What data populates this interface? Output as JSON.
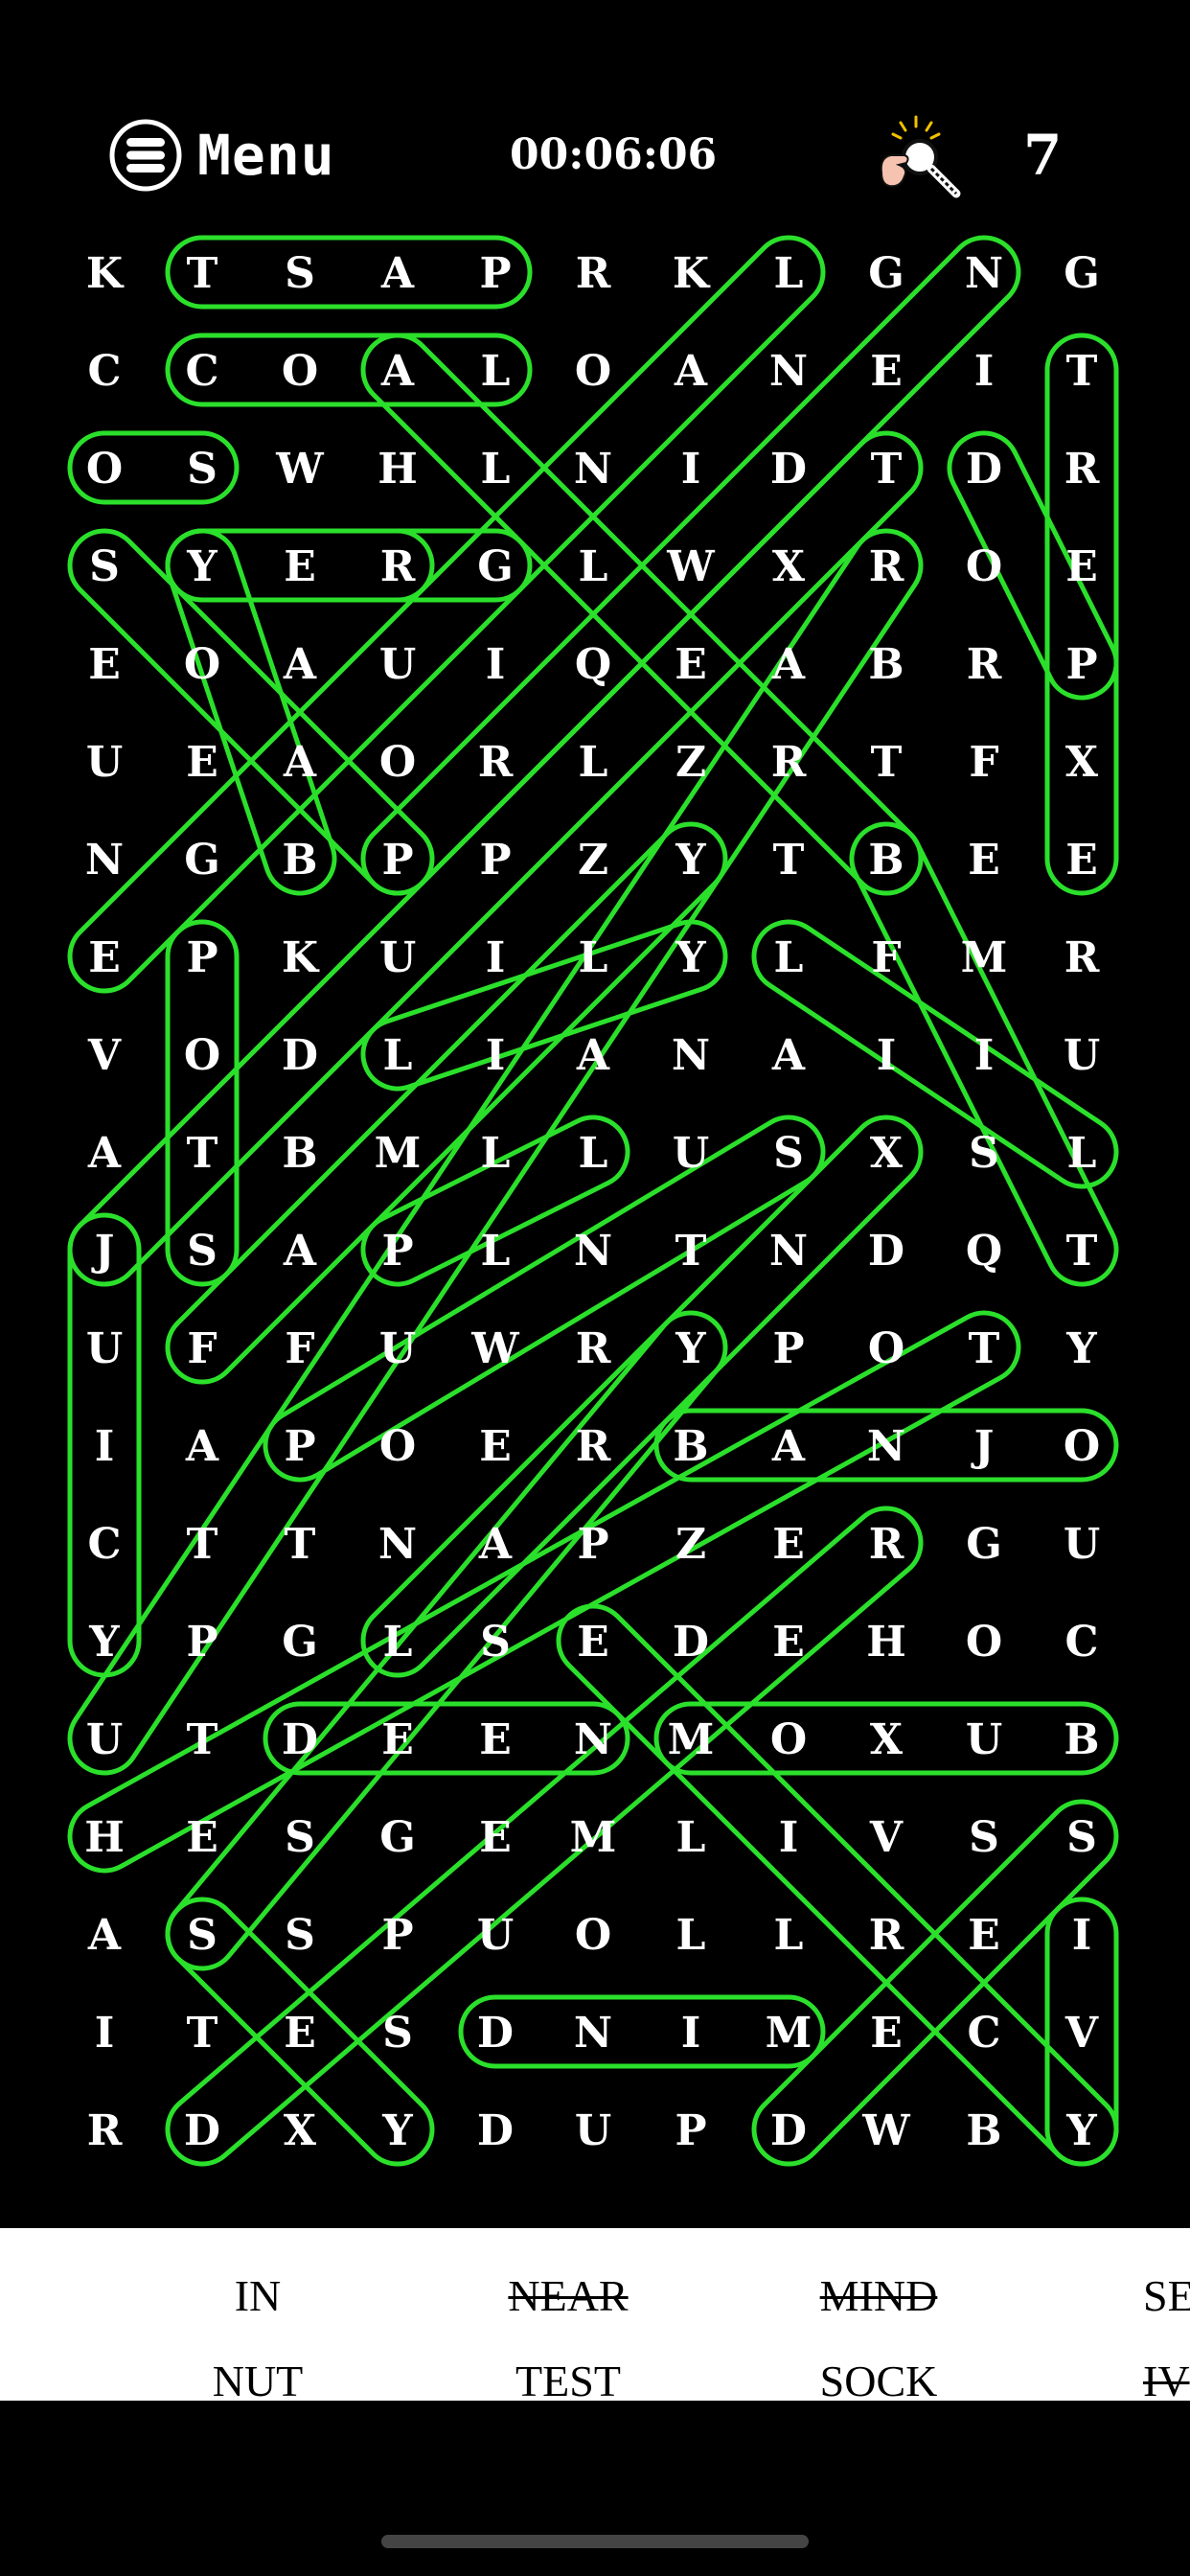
{
  "header": {
    "menu_label": "Menu",
    "timer": "00:06:06",
    "hint_count": "7"
  },
  "grid": [
    "KTSAPRKLGNG",
    "CCOALOANEIT",
    "OSWHLNIDTDR",
    "SYERGLWXROE",
    "EOAUIQEABRP",
    "UEAORLZRTFX",
    "NGBPPZYTBEE",
    "EPKUILYLFMR",
    "VODLIANAIIU",
    "ATBMLLUSXSL",
    "JSAPLNTNDQT",
    "UFFUWRYPOTY",
    "IAPOERBANJO",
    "CTTNAPZERGU",
    "YPGLSEDEHOC",
    "UTDEENMOXUB",
    "HESGEMLIVSS",
    "ASSPUOLLREI",
    "ITESDNIMECV",
    "RDXYDUPDWBY"
  ],
  "found_words": [
    {
      "from": [
        0,
        1
      ],
      "to": [
        0,
        4
      ]
    },
    {
      "from": [
        1,
        1
      ],
      "to": [
        1,
        4
      ]
    },
    {
      "from": [
        2,
        0
      ],
      "to": [
        2,
        1
      ]
    },
    {
      "from": [
        3,
        1
      ],
      "to": [
        3,
        3
      ]
    },
    {
      "from": [
        3,
        1
      ],
      "to": [
        3,
        4
      ]
    },
    {
      "from": [
        1,
        10
      ],
      "to": [
        6,
        10
      ]
    },
    {
      "from": [
        12,
        6
      ],
      "to": [
        12,
        10
      ]
    },
    {
      "from": [
        15,
        2
      ],
      "to": [
        15,
        5
      ]
    },
    {
      "from": [
        15,
        6
      ],
      "to": [
        15,
        10
      ]
    },
    {
      "from": [
        18,
        4
      ],
      "to": [
        18,
        7
      ]
    },
    {
      "from": [
        7,
        1
      ],
      "to": [
        10,
        1
      ]
    },
    {
      "from": [
        10,
        0
      ],
      "to": [
        14,
        0
      ]
    },
    {
      "from": [
        17,
        10
      ],
      "to": [
        19,
        10
      ]
    },
    {
      "from": [
        0,
        9
      ],
      "to": [
        6,
        3
      ]
    },
    {
      "from": [
        0,
        7
      ],
      "to": [
        7,
        0
      ]
    },
    {
      "from": [
        3,
        8
      ],
      "to": [
        15,
        0
      ]
    },
    {
      "from": [
        1,
        3
      ],
      "to": [
        6,
        8
      ]
    },
    {
      "from": [
        3,
        0
      ],
      "to": [
        6,
        3
      ]
    },
    {
      "from": [
        3,
        1
      ],
      "to": [
        6,
        2
      ]
    },
    {
      "from": [
        2,
        8
      ],
      "to": [
        10,
        0
      ]
    },
    {
      "from": [
        2,
        9
      ],
      "to": [
        4,
        10
      ]
    },
    {
      "from": [
        6,
        6
      ],
      "to": [
        11,
        1
      ]
    },
    {
      "from": [
        6,
        8
      ],
      "to": [
        10,
        10
      ]
    },
    {
      "from": [
        7,
        6
      ],
      "to": [
        8,
        3
      ]
    },
    {
      "from": [
        9,
        5
      ],
      "to": [
        10,
        3
      ]
    },
    {
      "from": [
        9,
        7
      ],
      "to": [
        12,
        2
      ]
    },
    {
      "from": [
        9,
        8
      ],
      "to": [
        14,
        3
      ]
    },
    {
      "from": [
        11,
        9
      ],
      "to": [
        16,
        0
      ]
    },
    {
      "from": [
        13,
        8
      ],
      "to": [
        19,
        1
      ]
    },
    {
      "from": [
        7,
        7
      ],
      "to": [
        9,
        10
      ]
    },
    {
      "from": [
        14,
        5
      ],
      "to": [
        19,
        10
      ]
    },
    {
      "from": [
        16,
        10
      ],
      "to": [
        19,
        7
      ]
    },
    {
      "from": [
        17,
        1
      ],
      "to": [
        19,
        3
      ]
    },
    {
      "from": [
        11,
        6
      ],
      "to": [
        17,
        1
      ]
    }
  ],
  "word_list": [
    {
      "text": "IN",
      "found": false
    },
    {
      "text": "NEAR",
      "found": true
    },
    {
      "text": "MIND",
      "found": true
    },
    {
      "text": "SE",
      "found": false
    },
    {
      "text": "NUT",
      "found": false
    },
    {
      "text": "TEST",
      "found": false
    },
    {
      "text": "SOCK",
      "found": false
    },
    {
      "text": "IV",
      "found": true
    }
  ],
  "colors": {
    "background": "#000000",
    "letter": "#ffffff",
    "highlight": "#2be02b",
    "word_panel": "#ffffff"
  },
  "icons": {
    "menu": "hamburger-circle-icon",
    "hint": "hand-magnifier-hint-icon"
  }
}
